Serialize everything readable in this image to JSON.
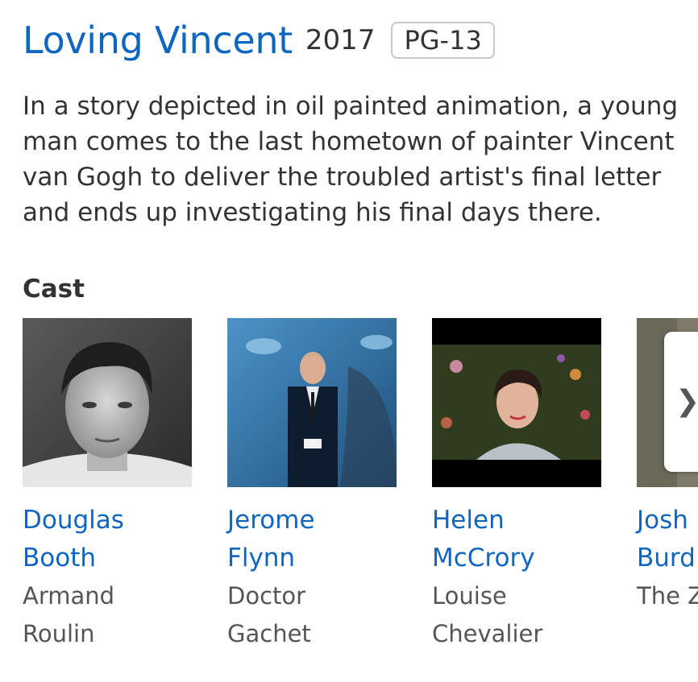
{
  "movie": {
    "title": "Loving Vincent",
    "year": "2017",
    "rating": "PG-13",
    "synopsis_lines": [
      "In a story depicted in oil painted animation, a young",
      "man comes to the last hometown of painter Vincent",
      "van Gogh to deliver the troubled artist's final letter",
      "and ends up investigating his final days there."
    ]
  },
  "cast_section": {
    "heading": "Cast",
    "members": [
      {
        "name_line1": "Douglas",
        "name_line2": "Booth",
        "role_line1": "Armand",
        "role_line2": "Roulin"
      },
      {
        "name_line1": "Jerome",
        "name_line2": "Flynn",
        "role_line1": "Doctor",
        "role_line2": "Gachet"
      },
      {
        "name_line1": "Helen",
        "name_line2": "McCrory",
        "role_line1": "Louise",
        "role_line2": "Chevalier"
      },
      {
        "name_line1": "Josh",
        "name_line2": "Burd",
        "role_line1": "The Z",
        "role_line2": ""
      }
    ],
    "next_icon": "chevron-right-icon"
  },
  "colors": {
    "link_blue": "#0f66c0",
    "text_dark": "#333333",
    "text_muted": "#555555"
  }
}
